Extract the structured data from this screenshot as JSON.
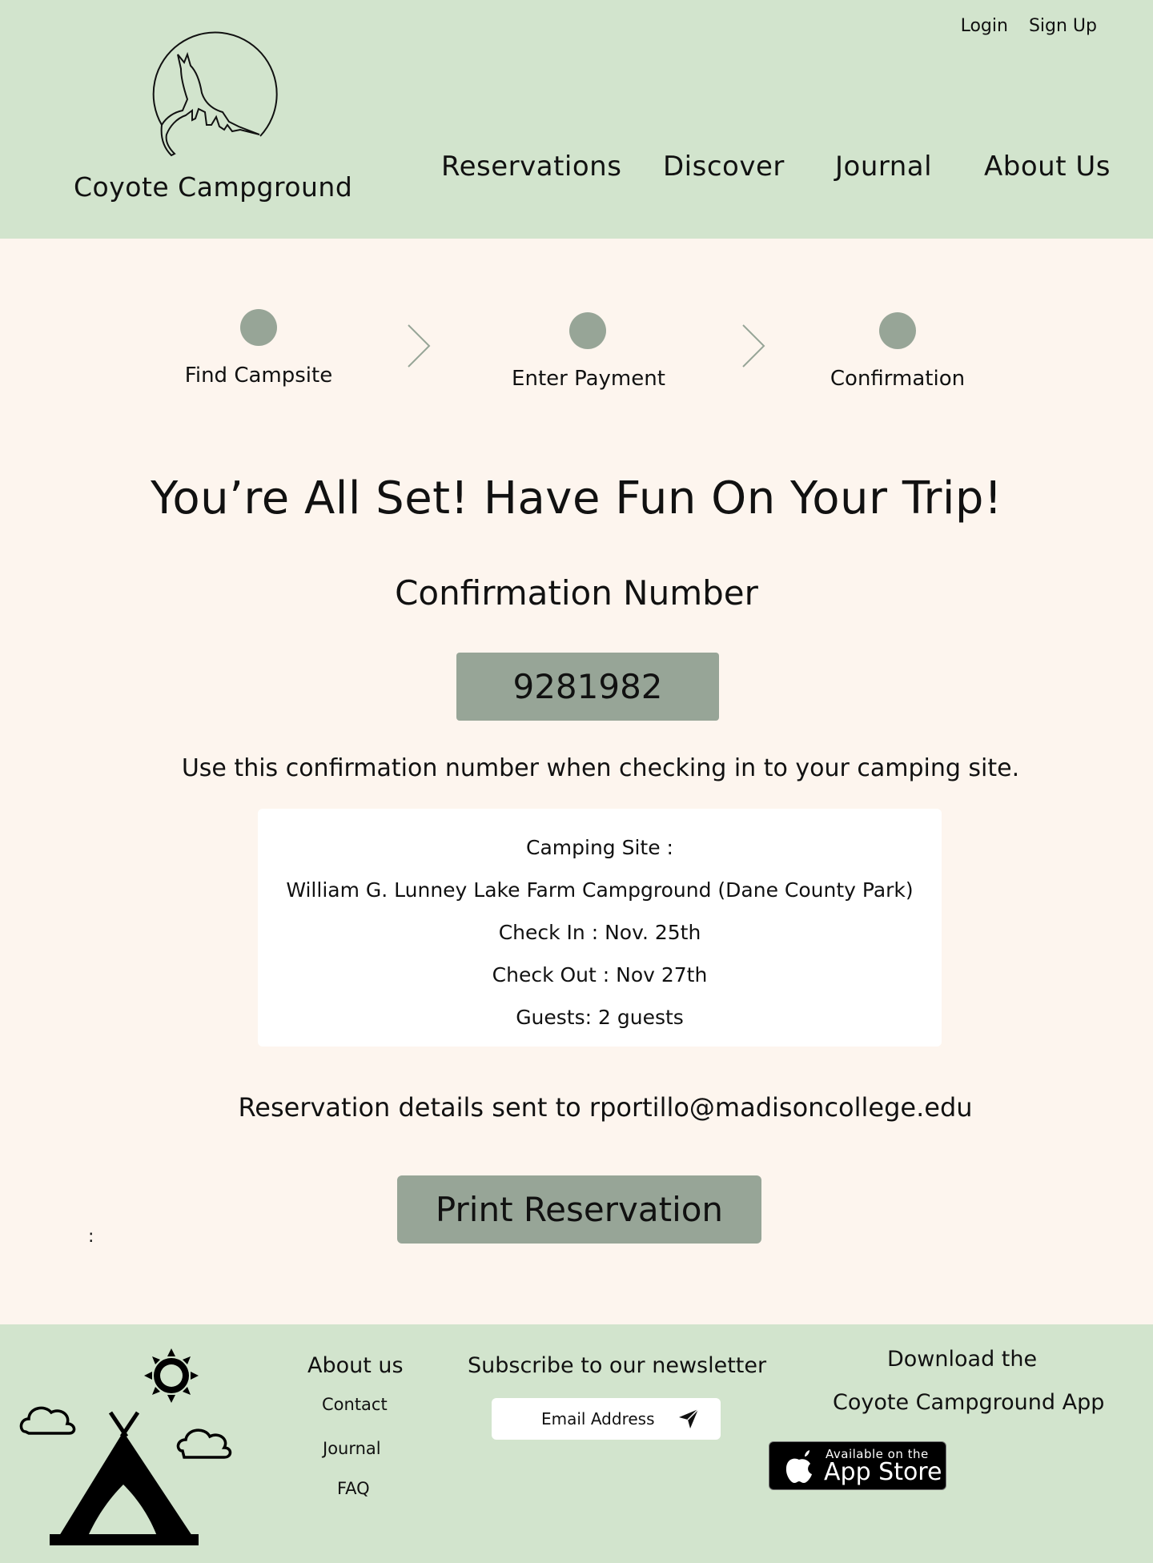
{
  "header": {
    "brand": "Coyote Campground",
    "auth": {
      "login": "Login",
      "signup": "Sign Up"
    },
    "nav": [
      "Reservations",
      "Discover",
      "Journal",
      "About Us"
    ]
  },
  "steps": [
    "Find Campsite",
    "Enter Payment",
    "Confirmation"
  ],
  "main": {
    "headline": "You’re All Set! Have Fun On Your Trip!",
    "confirmation_title": "Confirmation Number",
    "confirmation_number": "9281982",
    "note": "Use this confirmation number when checking in to your camping site.",
    "details": {
      "site_label": "Camping Site :",
      "site_name": "William G. Lunney Lake Farm  Campground (Dane County Park)",
      "check_in": "Check In : Nov. 25th",
      "check_out": "Check Out : Nov 27th",
      "guests": "Guests: 2 guests"
    },
    "sent_to": "Reservation details sent to rportillo@madisoncollege.edu",
    "print_label": "Print Reservation",
    "stray_colon": ":"
  },
  "footer": {
    "about_title": "About us",
    "about_links": [
      "Contact",
      "Journal",
      "FAQ"
    ],
    "newsletter_title": "Subscribe to our newsletter",
    "email_placeholder": "Email Address",
    "download_line1": "Download the",
    "download_line2": "Coyote Campground App",
    "badge_small": "Available on the",
    "badge_big": "App Store"
  },
  "colors": {
    "header_bg": "#d2e4cd",
    "page_bg": "#fdf5ee",
    "accent": "#97a597"
  }
}
